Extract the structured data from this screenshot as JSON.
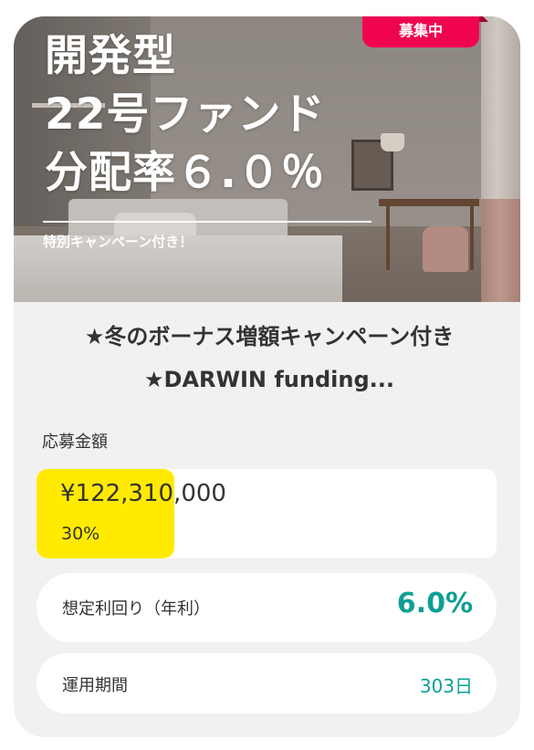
{
  "card": {
    "hero": {
      "title_lines": [
        "開発型",
        "22号ファンド",
        "分配率６.０％"
      ],
      "subtitle": "特別キャンペーン付き！",
      "status_badge": "募集中"
    },
    "fund_name": "★冬のボーナス増額キャンペーン付き★DARWIN funding...",
    "amount_section": {
      "label": "応募金額",
      "amount": "¥122,310,000",
      "percent_text": "30%",
      "progress_fraction": 0.3
    },
    "expected_yield": {
      "label": "想定利回り（年利）",
      "value": "6.0%"
    },
    "term": {
      "label": "運用期間",
      "value": "303日"
    }
  },
  "colors": {
    "badge": "#f0044f",
    "progress": "#ffea00",
    "accent_value": "#0e9f94",
    "card_bg": "#f1f1f1"
  }
}
